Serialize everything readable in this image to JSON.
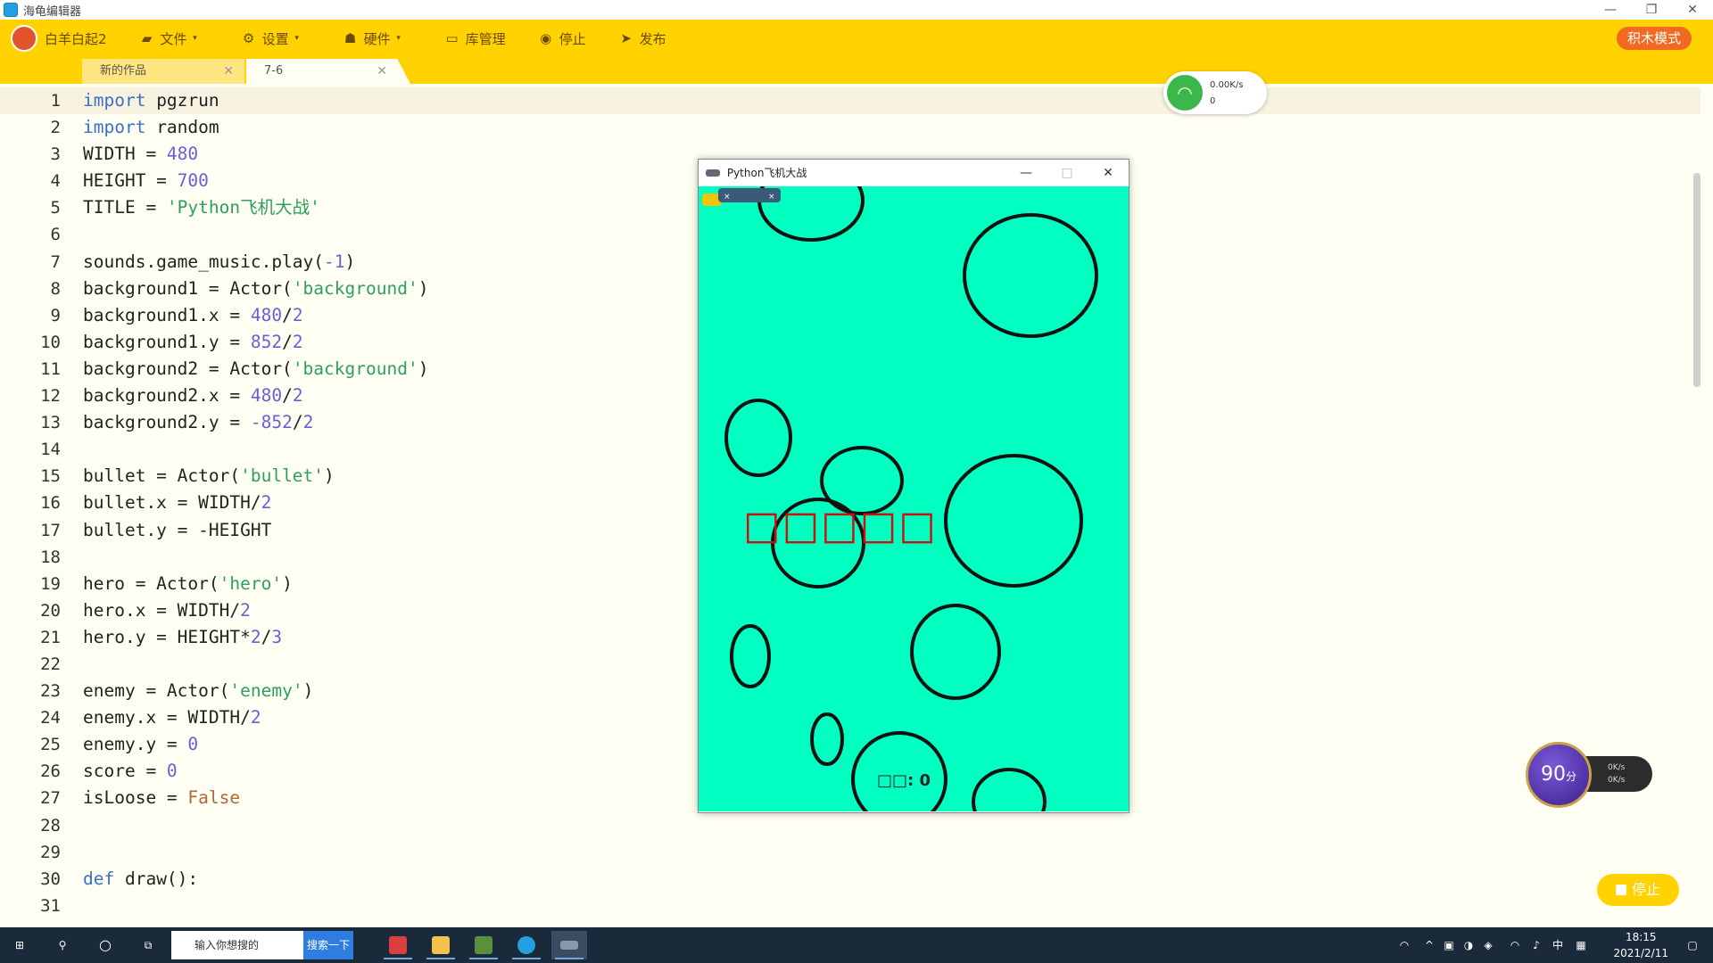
{
  "window": {
    "title": "海龟编辑器",
    "controls": [
      "—",
      "❐",
      "✕"
    ]
  },
  "toolbar": {
    "items": [
      {
        "label": "白羊白起2",
        "icon": "avatar"
      },
      {
        "label": "文件",
        "icon": "folder-icon",
        "dropdown": true
      },
      {
        "label": "设置",
        "icon": "gear-icon",
        "dropdown": true
      },
      {
        "label": "硬件",
        "icon": "hardware-icon",
        "dropdown": true
      },
      {
        "label": "库管理",
        "icon": "library-icon"
      },
      {
        "label": "停止",
        "icon": "stop-icon"
      },
      {
        "label": "发布",
        "icon": "send-icon"
      }
    ],
    "block_mode": "积木模式"
  },
  "tabs": [
    {
      "label": "新的作品"
    },
    {
      "label": "7-6",
      "active": true
    }
  ],
  "editor": {
    "line_numbers": [
      "1",
      "2",
      "3",
      "4",
      "5",
      "6",
      "7",
      "8",
      "9",
      "10",
      "11",
      "12",
      "13",
      "14",
      "15",
      "16",
      "17",
      "18",
      "19",
      "20",
      "21",
      "22",
      "23",
      "24",
      "25",
      "26",
      "27",
      "28",
      "29",
      "30",
      "31"
    ],
    "lines": [
      "import pgzrun",
      "import random",
      "WIDTH = 480",
      "HEIGHT = 700",
      "TITLE = 'Python飞机大战'",
      "",
      "sounds.game_music.play(-1)",
      "background1 = Actor('background')",
      "background1.x = 480/2",
      "background1.y = 852/2",
      "background2 = Actor('background')",
      "background2.x = 480/2",
      "background2.y = -852/2",
      "",
      "bullet = Actor('bullet')",
      "bullet.x = WIDTH/2",
      "bullet.y = -HEIGHT",
      "",
      "hero = Actor('hero')",
      "hero.x = WIDTH/2",
      "hero.y = HEIGHT*2/3",
      "",
      "enemy = Actor('enemy')",
      "enemy.x = WIDTH/2",
      "enemy.y = 0",
      "score = 0",
      "isLoose = False",
      "",
      "",
      "def draw():",
      ""
    ]
  },
  "network": {
    "speed": "0.00K/s",
    "count": "0"
  },
  "game_window": {
    "title": "Python飞机大战",
    "controls": [
      "—",
      "□",
      "✕"
    ],
    "score_text": "□□: 0",
    "overlay_text": "□□□□□",
    "background": "#00ffc0"
  },
  "perf_widget": {
    "score": "90",
    "unit": "分",
    "up": "0K/s",
    "down": "0K/s"
  },
  "stop_button": "停止",
  "taskbar": {
    "search_placeholder": "输入你想搜的",
    "search_button": "搜索一下",
    "time": "18:15",
    "date": "2021/2/11",
    "ime": "中"
  },
  "colors": {
    "toolbar": "#ffd200",
    "keyword": "#3b6fc9",
    "string": "#2e9f5c",
    "number": "#6d5ed6",
    "accent": "#f26a21"
  }
}
